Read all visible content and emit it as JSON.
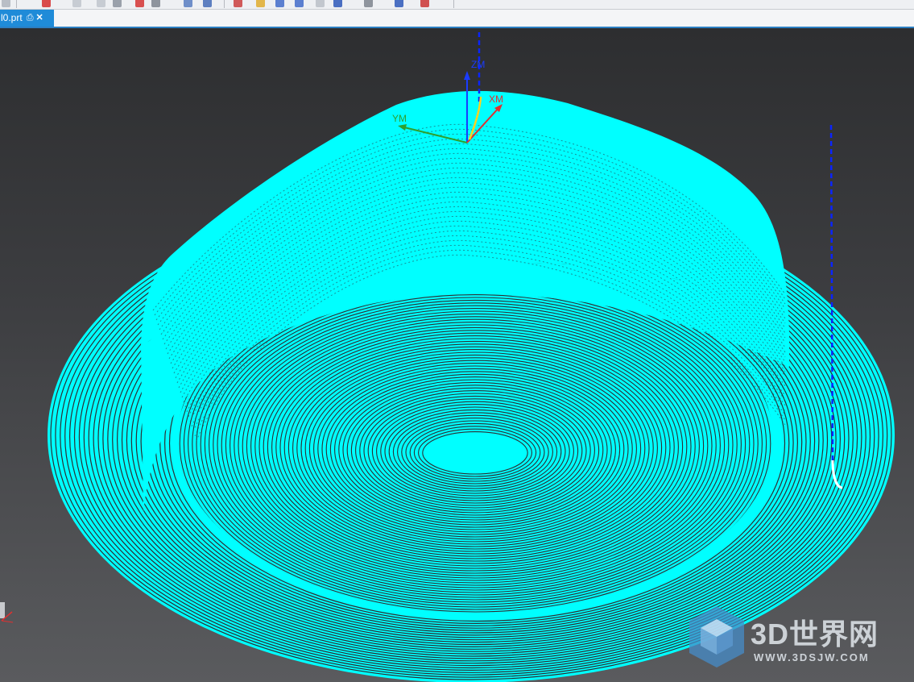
{
  "window": {
    "tab": {
      "label": "l0.prt",
      "pin_icon": "document-pin-icon",
      "close_label": "✕"
    }
  },
  "viewport": {
    "background": "#4a4b4e",
    "toolpath_color": "#00ffff",
    "wcs": {
      "z_label": "ZM",
      "x_label": "XM",
      "y_label": "YM",
      "z_color": "#1a3cff",
      "x_color": "#e03030",
      "y_color": "#2ea02e"
    }
  },
  "watermark": {
    "title": "3D世界网",
    "url": "WWW.3DSJW.COM"
  }
}
